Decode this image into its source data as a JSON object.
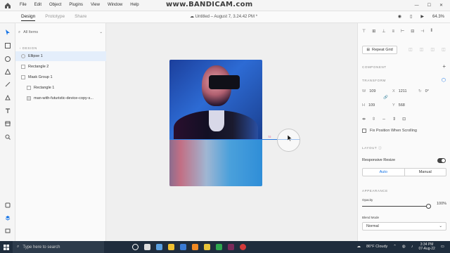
{
  "menu": [
    "File",
    "Edit",
    "Object",
    "Plugins",
    "View",
    "Window",
    "Help"
  ],
  "watermark": "www.BANDICAM.com",
  "tabs": [
    {
      "label": "Design",
      "active": true
    },
    {
      "label": "Prototype",
      "active": false
    },
    {
      "label": "Share",
      "active": false
    }
  ],
  "document_title": "Untitled – August 7, 3.24.42 PM *",
  "zoom": "64.3%",
  "layers": {
    "search_placeholder": "All Items",
    "group_label": "DESIGN",
    "items": [
      {
        "label": "Ellipse 1",
        "type": "ellipse",
        "selected": true
      },
      {
        "label": "Rectangle 2",
        "type": "rect",
        "selected": false
      },
      {
        "label": "Mask Group 1",
        "type": "group",
        "selected": false
      },
      {
        "label": "Rectangle 1",
        "type": "rect",
        "selected": false
      },
      {
        "label": "man-with-futuristic-device-copy-s...",
        "type": "image",
        "selected": false
      }
    ]
  },
  "canvas": {
    "measurement": "72"
  },
  "properties": {
    "repeat_grid": "Repeat Grid",
    "component_label": "COMPONENT",
    "transform_label": "TRANSFORM",
    "w_label": "W",
    "w_value": "109",
    "x_label": "X",
    "x_value": "1211",
    "rotation": "0°",
    "h_label": "H",
    "h_value": "109",
    "y_label": "Y",
    "y_value": "568",
    "fix_position": "Fix Position When Scrolling",
    "layout_label": "LAYOUT",
    "responsive_resize": "Responsive Resize",
    "auto": "Auto",
    "manual": "Manual",
    "appearance_label": "APPEARANCE",
    "opacity_label": "Opacity",
    "opacity_value": "100%",
    "opacity_fraction": 1.0,
    "blend_label": "Blend Mode",
    "blend_value": "Normal"
  },
  "taskbar": {
    "search_placeholder": "Type here to search",
    "weather": "86°F  Cloudy",
    "time": "3:34 PM",
    "date": "07-Aug-22"
  },
  "colors": {
    "accent": "#1473e6",
    "selection": "#2d7be0",
    "taskbar": "#1f2d3d"
  }
}
